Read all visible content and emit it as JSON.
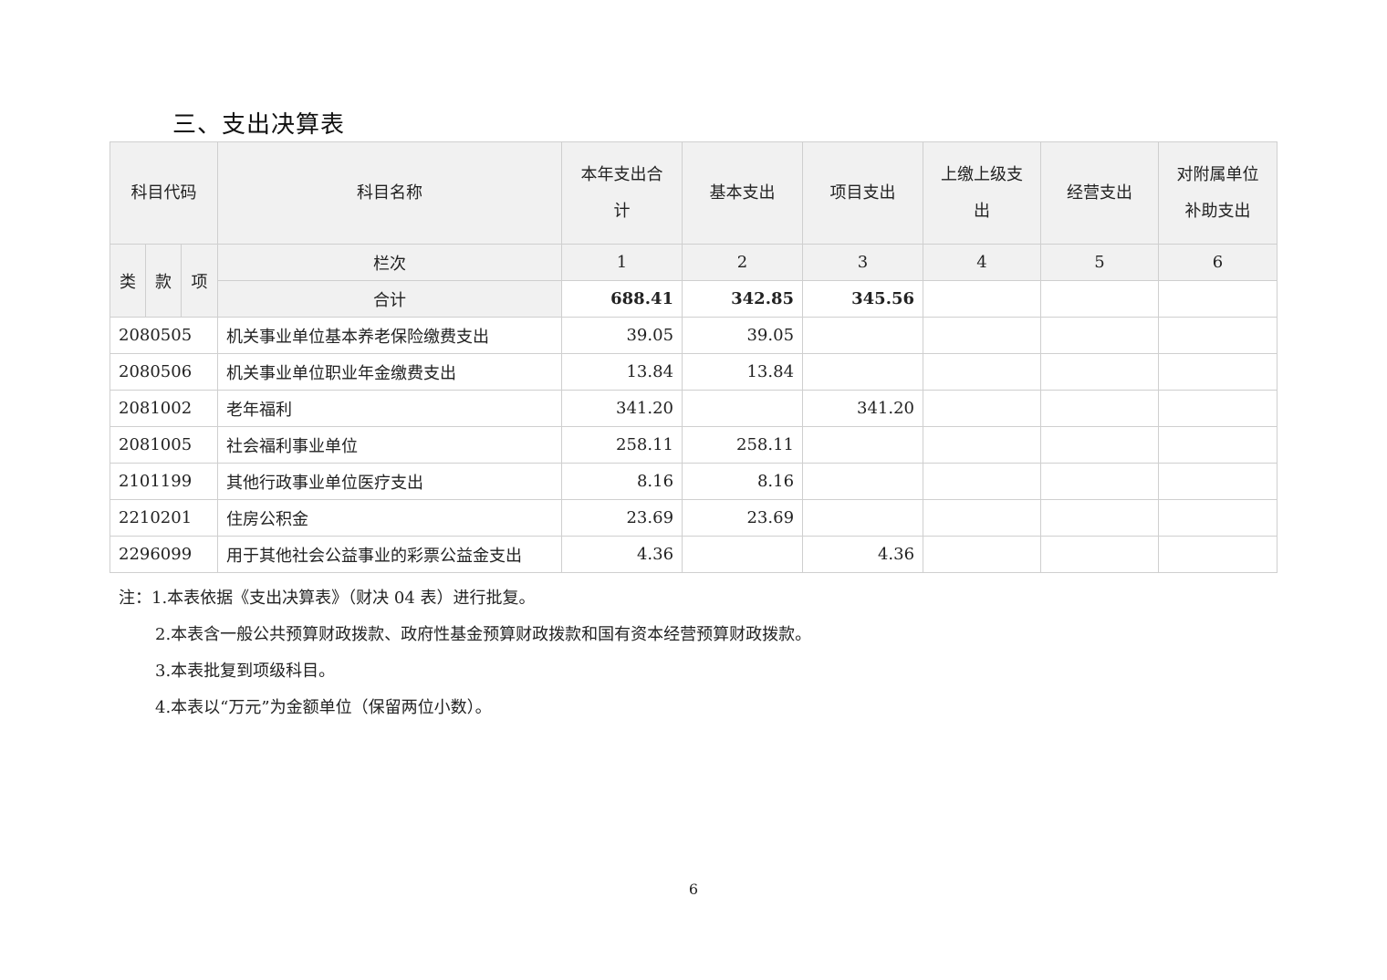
{
  "title": "三、支出决算表",
  "header": {
    "code": "科目代码",
    "name": "科目名称",
    "col1": "本年支出合计",
    "col2": "基本支出",
    "col3": "项目支出",
    "col4": "上缴上级支出",
    "col5": "经营支出",
    "col6": "对附属单位补助支出",
    "lei": "类",
    "kuan": "款",
    "xiang": "项",
    "lanci": "栏次",
    "nums": [
      "1",
      "2",
      "3",
      "4",
      "5",
      "6"
    ]
  },
  "total": {
    "label": "合计",
    "values": [
      "688.41",
      "342.85",
      "345.56",
      "",
      "",
      ""
    ]
  },
  "rows": [
    {
      "code": "2080505",
      "name": "机关事业单位基本养老保险缴费支出",
      "values": [
        "39.05",
        "39.05",
        "",
        "",
        "",
        ""
      ]
    },
    {
      "code": "2080506",
      "name": "机关事业单位职业年金缴费支出",
      "values": [
        "13.84",
        "13.84",
        "",
        "",
        "",
        ""
      ]
    },
    {
      "code": "2081002",
      "name": "老年福利",
      "values": [
        "341.20",
        "",
        "341.20",
        "",
        "",
        ""
      ]
    },
    {
      "code": "2081005",
      "name": "社会福利事业单位",
      "values": [
        "258.11",
        "258.11",
        "",
        "",
        "",
        ""
      ]
    },
    {
      "code": "2101199",
      "name": "其他行政事业单位医疗支出",
      "values": [
        "8.16",
        "8.16",
        "",
        "",
        "",
        ""
      ]
    },
    {
      "code": "2210201",
      "name": "住房公积金",
      "values": [
        "23.69",
        "23.69",
        "",
        "",
        "",
        ""
      ]
    },
    {
      "code": "2296099",
      "name": "用于其他社会公益事业的彩票公益金支出",
      "values": [
        "4.36",
        "",
        "4.36",
        "",
        "",
        ""
      ]
    }
  ],
  "notes": [
    "注：1.本表依据《支出决算表》（财决 04 表）进行批复。",
    "2.本表含一般公共预算财政拨款、政府性基金预算财政拨款和国有资本经营预算财政拨款。",
    "3.本表批复到项级科目。",
    "4.本表以“万元”为金额单位（保留两位小数）。"
  ],
  "page_number": "6"
}
